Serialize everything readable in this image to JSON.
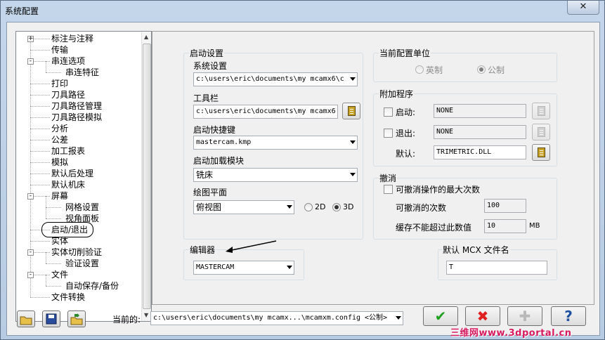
{
  "window": {
    "title": "系统配置",
    "close_glyph": "✕"
  },
  "tree": {
    "items": [
      {
        "label": "标注与注释",
        "expander": "+"
      },
      {
        "label": "传输"
      },
      {
        "label": "串连选项",
        "expander": "-"
      },
      {
        "label": "串连特征",
        "child": true
      },
      {
        "label": "打印"
      },
      {
        "label": "刀具路径"
      },
      {
        "label": "刀具路径管理"
      },
      {
        "label": "刀具路径模拟"
      },
      {
        "label": "分析"
      },
      {
        "label": "公差"
      },
      {
        "label": "加工报表"
      },
      {
        "label": "模拟"
      },
      {
        "label": "默认后处理"
      },
      {
        "label": "默认机床"
      },
      {
        "label": "屏幕",
        "expander": "-"
      },
      {
        "label": "网格设置",
        "child": true
      },
      {
        "label": "视角面板",
        "child": true
      },
      {
        "label": "启动/退出",
        "selected": true
      },
      {
        "label": "实体"
      },
      {
        "label": "实体切削验证",
        "expander": "-"
      },
      {
        "label": "验证设置",
        "child": true
      },
      {
        "label": "文件",
        "expander": "-"
      },
      {
        "label": "自动保存/备份",
        "child": true
      },
      {
        "label": "文件转换"
      }
    ]
  },
  "startup": {
    "group_label": "启动设置",
    "system_label": "系统设置",
    "system_value": "c:\\users\\eric\\documents\\my mcamx6\\c",
    "toolbar_label": "工具栏",
    "toolbar_value": "c:\\users\\eric\\documents\\my mcamx6'",
    "shortcut_label": "启动快捷键",
    "shortcut_value": "mastercam.kmp",
    "module_label": "启动加载模块",
    "module_value": "铣床",
    "plane_label": "绘图平面",
    "plane_value": "俯视图",
    "radio_2d": "2D",
    "radio_3d": "3D"
  },
  "units": {
    "group_label": "当前配置单位",
    "inch": "英制",
    "metric": "公制"
  },
  "addons": {
    "group_label": "附加程序",
    "startup_label": "启动:",
    "startup_value": "NONE",
    "exit_label": "退出:",
    "exit_value": "NONE",
    "default_label": "默认:",
    "default_value": "TRIMETRIC.DLL"
  },
  "undo": {
    "group_label": "撤消",
    "max_label": "可撤消操作的最大次数",
    "count_label": "可撤消的次数",
    "count_value": "100",
    "mem_label": "缓存不能超过此数值",
    "mem_value": "10",
    "mem_unit": "MB"
  },
  "editor": {
    "group_label": "编辑器",
    "value": "MASTERCAM"
  },
  "mcx": {
    "group_label": "默认 MCX 文件名",
    "value": "T"
  },
  "footer": {
    "current_label": "当前的:",
    "current_value": "c:\\users\\eric\\documents\\my mcamx...\\mcamxm.config <公制>",
    "ok_glyph": "✔",
    "cancel_glyph": "✖",
    "apply_glyph": "✚",
    "help_glyph": "?"
  },
  "watermark": "三维网www.3dportal.cn",
  "colors": {
    "ok": "#20a020",
    "cancel": "#e02020",
    "apply": "#c0c0c0",
    "help": "#2050a0"
  }
}
